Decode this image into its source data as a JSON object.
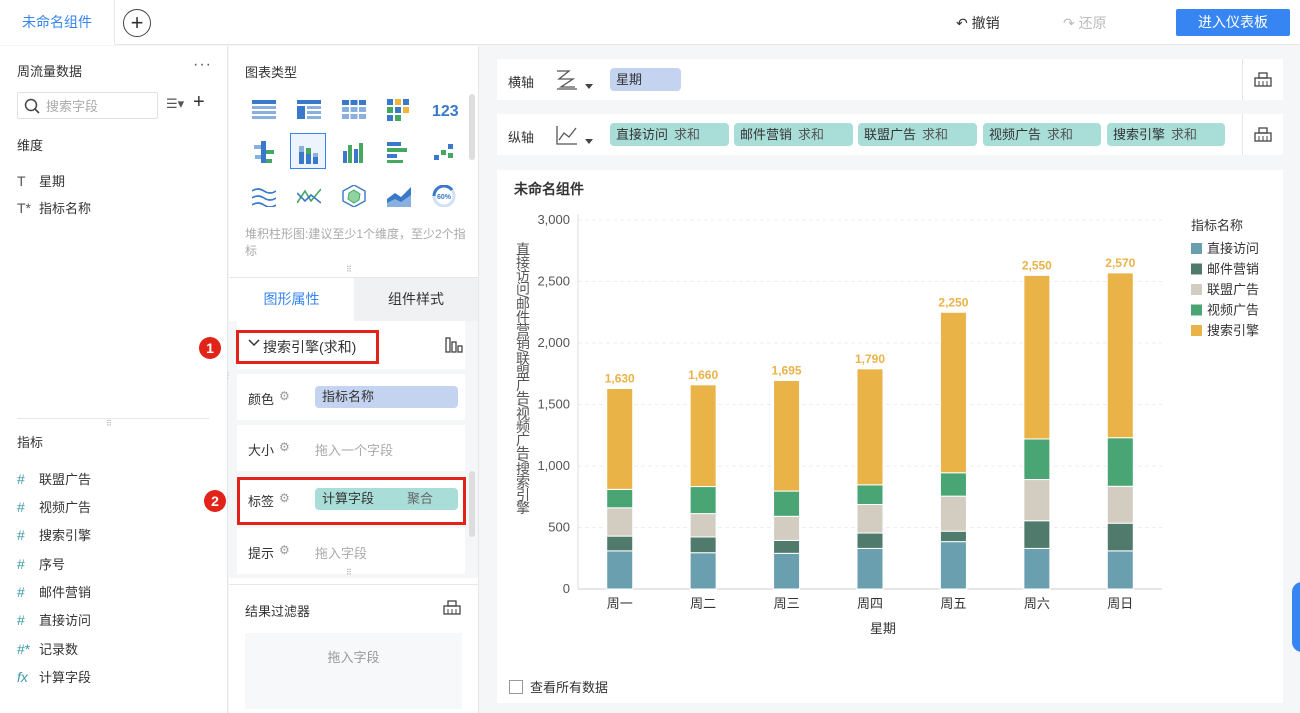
{
  "topbar": {
    "tab_title": "未命名组件",
    "add_tab": "+",
    "undo": "撤销",
    "redo": "还原",
    "enter": "进入仪表板"
  },
  "left": {
    "dataset": "周流量数据",
    "more": "···",
    "search_placeholder": "搜索字段",
    "dimension_label": "维度",
    "dimensions": [
      {
        "icon": "T",
        "label": "星期"
      },
      {
        "icon": "T*",
        "label": "指标名称"
      }
    ],
    "metric_label": "指标",
    "metrics": [
      {
        "icon": "#",
        "label": "联盟广告"
      },
      {
        "icon": "#",
        "label": "视频广告"
      },
      {
        "icon": "#",
        "label": "搜索引擎"
      },
      {
        "icon": "#",
        "label": "序号"
      },
      {
        "icon": "#",
        "label": "邮件营销"
      },
      {
        "icon": "#",
        "label": "直接访问"
      },
      {
        "icon": "#*",
        "label": "记录数"
      },
      {
        "icon": "fx",
        "label": "计算字段"
      }
    ]
  },
  "mid": {
    "chart_type_title": "图表类型",
    "hint": "堆积柱形图:建议至少1个维度，至少2个指标",
    "tab_graph": "图形属性",
    "tab_style": "组件样式",
    "series": "搜索引擎(求和)",
    "props": {
      "color_label": "颜色",
      "color_value": "指标名称",
      "size_label": "大小",
      "size_placeholder": "拖入一个字段",
      "label_label": "标签",
      "label_value": "计算字段",
      "label_agg": "聚合",
      "tip_label": "提示",
      "tip_placeholder": "拖入字段"
    },
    "filter_title": "结果过滤器",
    "filter_placeholder": "拖入字段"
  },
  "annotations": {
    "one": "1",
    "two": "2"
  },
  "axes": {
    "x_label": "横轴",
    "x_field": "星期",
    "y_label": "纵轴",
    "y_fields": [
      {
        "name": "直接访问",
        "agg": "求和"
      },
      {
        "name": "邮件营销",
        "agg": "求和"
      },
      {
        "name": "联盟广告",
        "agg": "求和"
      },
      {
        "name": "视频广告",
        "agg": "求和"
      },
      {
        "name": "搜索引擎",
        "agg": "求和"
      }
    ]
  },
  "chart_card": {
    "title": "未命名组件",
    "view_all": "查看所有数据"
  },
  "chart_data": {
    "type": "bar",
    "stacked": true,
    "title": "未命名组件",
    "xlabel": "星期",
    "ylabel": "直接访问/邮件营销/联盟广告/视频广告/搜索引擎",
    "ylim": [
      0,
      3000
    ],
    "yticks": [
      "0",
      "500",
      "1,000",
      "1,500",
      "2,000",
      "2,500",
      "3,000"
    ],
    "categories": [
      "周一",
      "周二",
      "周三",
      "周四",
      "周五",
      "周六",
      "周日"
    ],
    "legend_title": "指标名称",
    "legend_position": "top-right",
    "totals_labels": [
      "1,630",
      "1,660",
      "1,695",
      "1,790",
      "2,250",
      "2,550",
      "2,570"
    ],
    "series": [
      {
        "name": "直接访问",
        "color": "#6a9fb0",
        "values": [
          310,
          295,
          290,
          330,
          385,
          330,
          310
        ]
      },
      {
        "name": "邮件营销",
        "color": "#4f7a6c",
        "values": [
          120,
          128,
          105,
          125,
          85,
          225,
          225
        ]
      },
      {
        "name": "联盟广告",
        "color": "#d3cdc1",
        "values": [
          230,
          190,
          196,
          232,
          285,
          335,
          300
        ]
      },
      {
        "name": "视频广告",
        "color": "#4aa574",
        "values": [
          150,
          220,
          205,
          160,
          190,
          330,
          395
        ]
      },
      {
        "name": "搜索引擎",
        "color": "#e9b348",
        "values": [
          820,
          827,
          899,
          943,
          1305,
          1330,
          1340
        ]
      }
    ],
    "grid": true
  }
}
